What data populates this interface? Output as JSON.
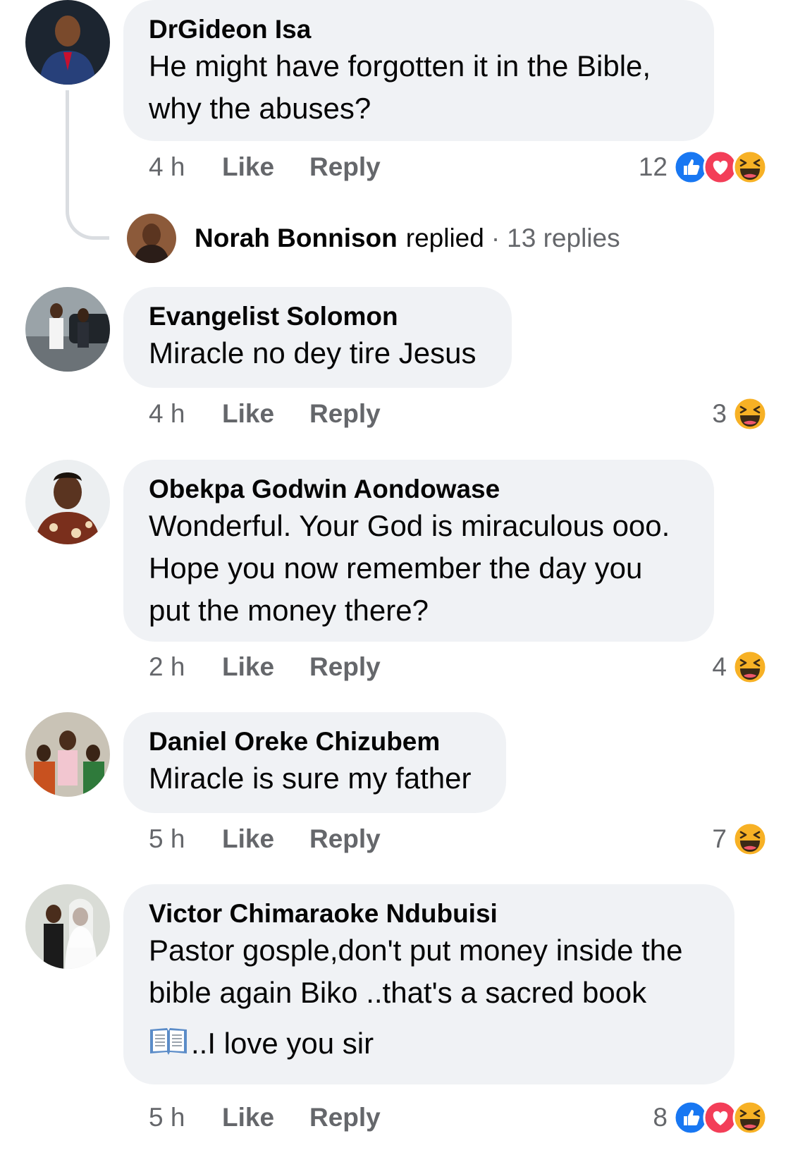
{
  "comments": [
    {
      "author": "DrGideon Isa",
      "text": "He might have  forgotten  it in the Bible,\nwhy the abuses?",
      "time": "4 h",
      "like": "Like",
      "reply": "Reply",
      "reaction_count": "12",
      "reactions": [
        "like-reaction-icon",
        "love-reaction-icon",
        "haha-reaction-icon"
      ]
    },
    {
      "author": "Evangelist Solomon",
      "text": "Miracle no dey tire Jesus",
      "time": "4 h",
      "like": "Like",
      "reply": "Reply",
      "reaction_count": "3",
      "reactions": [
        "haha-reaction-icon"
      ]
    },
    {
      "author": "Obekpa Godwin Aondowase",
      "text": "Wonderful. Your God is miraculous ooo.\nHope you now remember the day you\nput the money there?",
      "time": "2 h",
      "like": "Like",
      "reply": "Reply",
      "reaction_count": "4",
      "reactions": [
        "haha-reaction-icon"
      ]
    },
    {
      "author": "Daniel Oreke Chizubem",
      "text": "Miracle is sure my father",
      "time": "5 h",
      "like": "Like",
      "reply": "Reply",
      "reaction_count": "7",
      "reactions": [
        "haha-reaction-icon"
      ]
    },
    {
      "author": "Victor Chimaraoke Ndubuisi",
      "text": "Pastor gosple,don't put money inside the\nbible again Biko ..that's a sacred book",
      "text_line3": "..I love you sir",
      "time": "5 h",
      "like": "Like",
      "reply": "Reply",
      "reaction_count": "8",
      "reactions": [
        "like-reaction-icon",
        "love-reaction-icon",
        "haha-reaction-icon"
      ]
    }
  ],
  "thread": {
    "name": "Norah Bonnison",
    "verb": "replied",
    "dot": "·",
    "count": "13 replies"
  },
  "colors": {
    "bubble": "#f0f2f5",
    "meta_text": "#65676b",
    "like_blue": "#1877f2",
    "love_red": "#f33e58",
    "haha_yellow": "#f7b125"
  }
}
